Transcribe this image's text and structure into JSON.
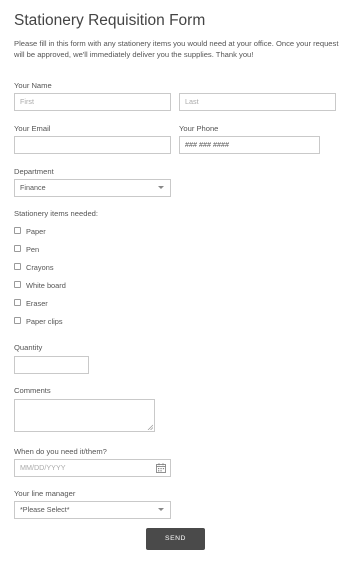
{
  "form": {
    "title": "Stationery Requisition Form",
    "intro": "Please fill in this form with any stationery items you would need at your office. Once your request will be approved, we'll immediately deliver you the supplies. Thank you!"
  },
  "name": {
    "label": "Your Name",
    "first_placeholder": "First",
    "last_placeholder": "Last"
  },
  "email": {
    "label": "Your Email",
    "value": ""
  },
  "phone": {
    "label": "Your Phone",
    "placeholder": "### ### ####"
  },
  "department": {
    "label": "Department",
    "selected": "Finance"
  },
  "items": {
    "label": "Stationery items needed:",
    "options": [
      "Paper",
      "Pen",
      "Crayons",
      "White board",
      "Eraser",
      "Paper clips"
    ]
  },
  "quantity": {
    "label": "Quantity",
    "value": ""
  },
  "comments": {
    "label": "Comments",
    "value": ""
  },
  "date": {
    "label": "When do you need it/them?",
    "placeholder": "MM/DD/YYYY"
  },
  "manager": {
    "label": "Your line manager",
    "selected": "*Please Select*"
  },
  "submit": {
    "label": "SEND"
  },
  "colors": {
    "button_bg": "#4a4a4a",
    "border": "#c9c9c9"
  },
  "icons": {
    "date": "calendar-icon",
    "dropdown": "chevron-down-icon",
    "resize": "resize-grip-icon"
  }
}
